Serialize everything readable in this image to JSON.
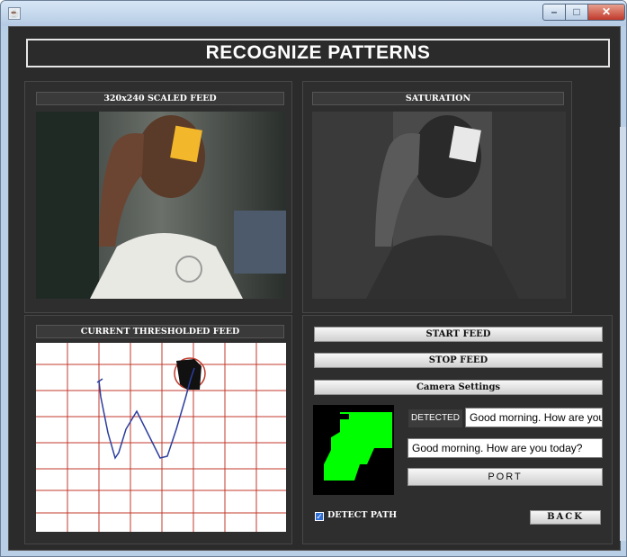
{
  "window": {
    "app_icon": "java-cup-icon",
    "minimize_icon": "minimize-icon",
    "maximize_icon": "maximize-icon",
    "close_icon": "close-icon"
  },
  "title": "RECOGNIZE PATTERNS",
  "panels": {
    "scaled_feed": "320x240 SCALED FEED",
    "saturation": "SATURATION",
    "thresholded": "CURRENT THRESHOLDED FEED"
  },
  "controls": {
    "start_feed": "START FEED",
    "stop_feed": "STOP FEED",
    "camera_settings": "Camera Settings",
    "detected_label": "DETECTED",
    "detected_value": "Good morning. How are you t",
    "message_value": "Good morning. How are  you today?",
    "port": "PORT",
    "detect_path": "DETECT PATH",
    "detect_path_checked": true,
    "back": "BACK"
  },
  "colors": {
    "background": "#2b2b2b",
    "grid": "#c0392b",
    "path": "#2c3e9e",
    "preview_green": "#00ff00"
  }
}
